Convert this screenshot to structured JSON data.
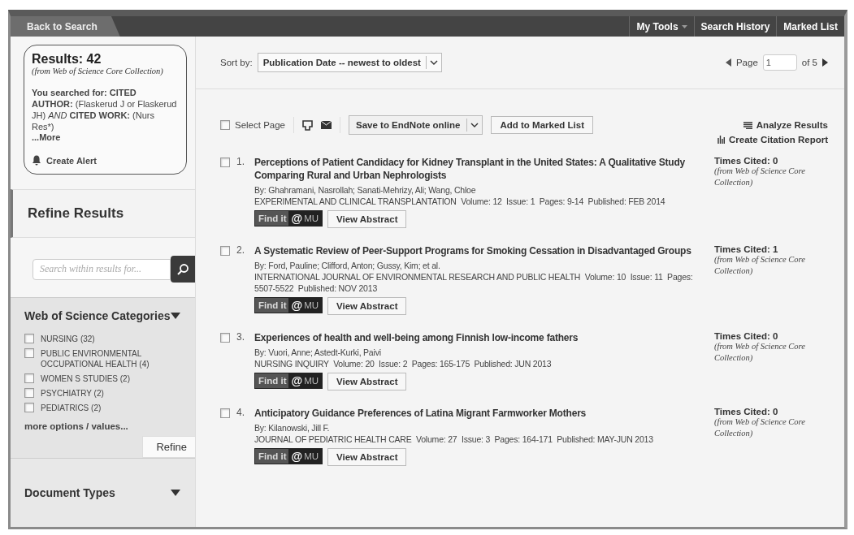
{
  "top_bar": {
    "back": "Back to Search",
    "menus": [
      {
        "label": "My Tools",
        "dropdown": true
      },
      {
        "label": "Search History",
        "dropdown": false
      },
      {
        "label": "Marked List",
        "dropdown": false
      }
    ]
  },
  "summary": {
    "results": "Results: 42",
    "source": "(from Web of Science Core Collection)",
    "query": "**You searched for: CITED AUTHOR:** (Flaskerud J or Flaskerud JH) *AND* **CITED WORK:** (Nurs Res*)",
    "more": "...More",
    "alert": "Create Alert"
  },
  "refine": {
    "title": "Refine Results",
    "search_placeholder": "Search within results for...",
    "categories": {
      "title": "Web of Science Categories",
      "expanded": true,
      "items": [
        {
          "label": "NURSING (32)",
          "checked": false
        },
        {
          "label": "PUBLIC ENVIRONMENTAL OCCUPATIONAL HEALTH (4)",
          "checked": false
        },
        {
          "label": "WOMEN S STUDIES (2)",
          "checked": false
        },
        {
          "label": "PSYCHIATRY (2)",
          "checked": false
        },
        {
          "label": "PEDIATRICS (2)",
          "checked": false
        }
      ],
      "more": "more options / values...",
      "button": "Refine"
    },
    "doc_types": {
      "title": "Document Types",
      "expanded": true
    }
  },
  "sort": {
    "label": "Sort by:",
    "value": "Publication Date -- newest to oldest"
  },
  "pager": {
    "label": "Page",
    "value": "1",
    "of": "of 5"
  },
  "toolbar": {
    "select_page": "Select Page",
    "select_checked": false,
    "save": "Save to EndNote online",
    "add": "Add to Marked List",
    "analyze": "Analyze Results",
    "citation": "Create Citation Report"
  },
  "records": [
    {
      "number": "1.",
      "checked": false,
      "title": "Perceptions of Patient Candidacy for Kidney Transplant in the United States: A Qualitative Study Comparing Rural and Urban Nephrologists",
      "authors": "By: Ghahramani, Nasrollah; Sanati-Mehrizy, Ali; Wang, Chloe",
      "source": "EXPERIMENTAL AND CLINICAL TRANSPLANTATION  Volume: 12  Issue: 1  Pages: 9-14  Published: FEB 2014",
      "find": {
        "label": "Find it",
        "at": "@",
        "org": "MU"
      },
      "abstract": "View Abstract",
      "cited": "Times Cited: 0",
      "cited_note": "(from Web of Science Core Collection)"
    },
    {
      "number": "2.",
      "checked": false,
      "title": "A Systematic Review of Peer-Support Programs for Smoking Cessation in Disadvantaged Groups",
      "authors": "By: Ford, Pauline; Clifford, Anton; Gussy, Kim; et al.",
      "source": "INTERNATIONAL JOURNAL OF ENVIRONMENTAL RESEARCH AND PUBLIC HEALTH  Volume: 10  Issue: 11  Pages: 5507-5522  Published: NOV 2013",
      "find": {
        "label": "Find it",
        "at": "@",
        "org": "MU"
      },
      "abstract": "View Abstract",
      "cited": "Times Cited: 1",
      "cited_note": "(from Web of Science Core Collection)"
    },
    {
      "number": "3.",
      "checked": false,
      "title": "Experiences of health and well-being among Finnish low-income fathers",
      "authors": "By: Vuori, Anne; Astedt-Kurki, Paivi",
      "source": "NURSING INQUIRY  Volume: 20  Issue: 2  Pages: 165-175  Published: JUN 2013",
      "find": {
        "label": "Find it",
        "at": "@",
        "org": "MU"
      },
      "abstract": "View Abstract",
      "cited": "Times Cited: 0",
      "cited_note": "(from Web of Science Core Collection)"
    },
    {
      "number": "4.",
      "checked": false,
      "title": "Anticipatory Guidance Preferences of Latina Migrant Farmworker Mothers",
      "authors": "By: Kilanowski, Jill F.",
      "source": "JOURNAL OF PEDIATRIC HEALTH CARE  Volume: 27  Issue: 3  Pages: 164-171  Published: MAY-JUN 2013",
      "find": {
        "label": "Find it",
        "at": "@",
        "org": "MU"
      },
      "abstract": "View Abstract",
      "cited": "Times Cited: 0",
      "cited_note": "(from Web of Science Core Collection)"
    }
  ]
}
